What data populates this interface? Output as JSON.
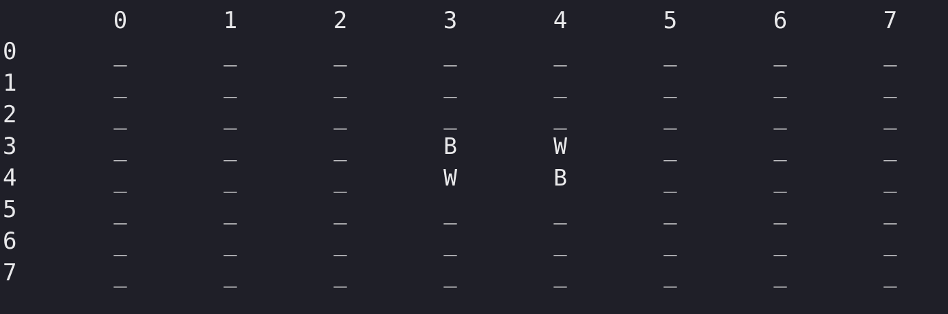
{
  "board": {
    "column_headers": [
      "0",
      "1",
      "2",
      "3",
      "4",
      "5",
      "6",
      "7"
    ],
    "row_labels": [
      "0",
      "1",
      "2",
      "3",
      "4",
      "5",
      "6",
      "7"
    ],
    "rows": [
      [
        "_",
        "_",
        "_",
        "_",
        "_",
        "_",
        "_",
        "_"
      ],
      [
        "_",
        "_",
        "_",
        "_",
        "_",
        "_",
        "_",
        "_"
      ],
      [
        "_",
        "_",
        "_",
        "_",
        "_",
        "_",
        "_",
        "_"
      ],
      [
        "_",
        "_",
        "_",
        "B",
        "W",
        "_",
        "_",
        "_"
      ],
      [
        "_",
        "_",
        "_",
        "W",
        "B",
        "_",
        "_",
        "_"
      ],
      [
        "_",
        "_",
        "_",
        "_",
        "_",
        "_",
        "_",
        "_"
      ],
      [
        "_",
        "_",
        "_",
        "_",
        "_",
        "_",
        "_",
        "_"
      ],
      [
        "_",
        "_",
        "_",
        "_",
        "_",
        "_",
        "_",
        "_"
      ]
    ]
  },
  "colors": {
    "background": "#1f1f28",
    "text": "#e8e8ea"
  }
}
